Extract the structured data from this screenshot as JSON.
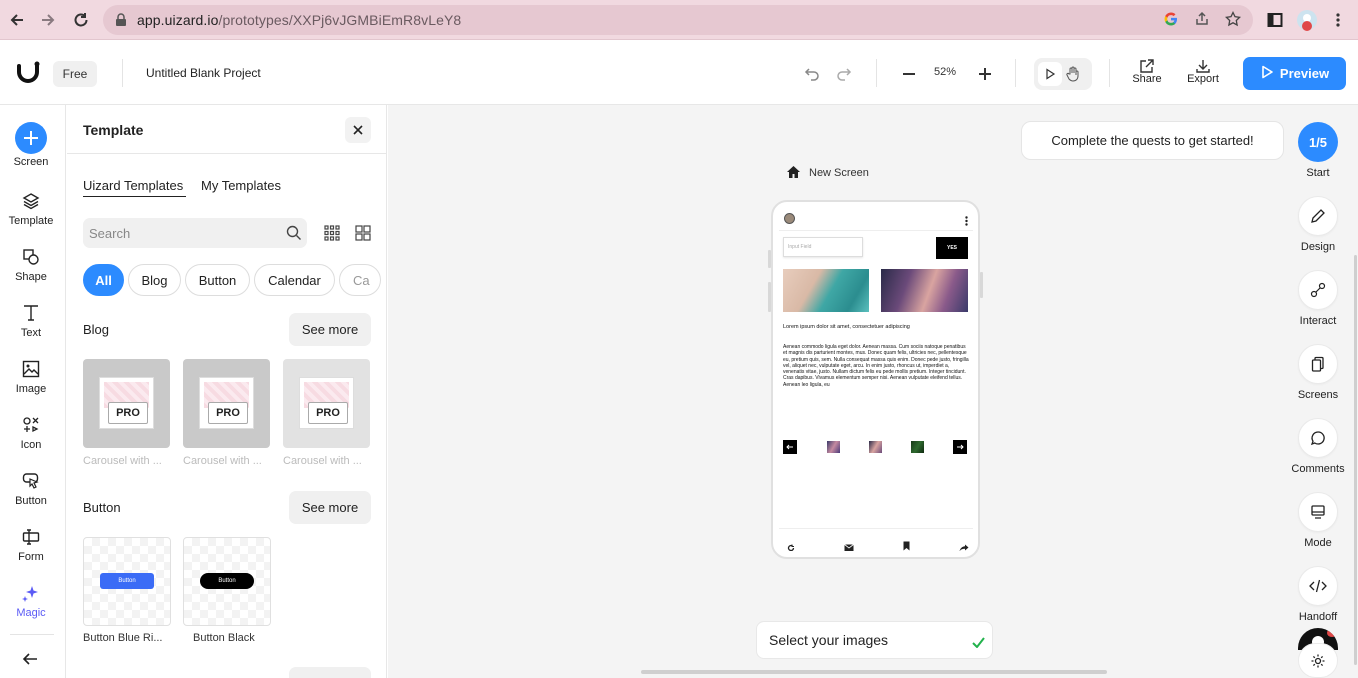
{
  "browser": {
    "url_domain": "app.uizard.io",
    "url_path": "/prototypes/XXPj6vJGMBiEmR8vLeY8"
  },
  "header": {
    "plan_badge": "Free",
    "project_title": "Untitled Blank Project",
    "zoom": "52%",
    "share_label": "Share",
    "export_label": "Export",
    "preview_label": "Preview"
  },
  "left_toolbar": {
    "items": [
      {
        "label": "Screen",
        "icon": "plus-icon"
      },
      {
        "label": "Template",
        "icon": "layers-icon"
      },
      {
        "label": "Shape",
        "icon": "shape-icon"
      },
      {
        "label": "Text",
        "icon": "text-icon"
      },
      {
        "label": "Image",
        "icon": "image-icon"
      },
      {
        "label": "Icon",
        "icon": "icon-set-icon"
      },
      {
        "label": "Button",
        "icon": "pointer-icon"
      },
      {
        "label": "Form",
        "icon": "form-icon"
      },
      {
        "label": "Magic",
        "icon": "sparkle-icon"
      }
    ],
    "accent_color": "#2c8bff",
    "magic_color": "#5b5bf5"
  },
  "template_panel": {
    "title": "Template",
    "tabs": [
      "Uizard Templates",
      "My Templates"
    ],
    "search_placeholder": "Search",
    "chips": [
      "All",
      "Blog",
      "Button",
      "Calendar",
      "Ca"
    ],
    "blog": {
      "heading": "Blog",
      "see_more": "See more",
      "cards": [
        {
          "badge": "PRO",
          "caption": "Carousel with ..."
        },
        {
          "badge": "PRO",
          "caption": "Carousel with ..."
        },
        {
          "badge": "PRO",
          "caption": "Carousel with ..."
        }
      ]
    },
    "button": {
      "heading": "Button",
      "see_more": "See more",
      "cards": [
        {
          "preview_label": "Button",
          "caption": "Button Blue Ri...",
          "color": "#3b6cf6"
        },
        {
          "preview_label": "Button",
          "caption": "Button Black",
          "color": "#000000"
        }
      ]
    }
  },
  "canvas": {
    "quest_text": "Complete the quests to get started!",
    "screen_name": "New Screen",
    "toast_text": "Select your images",
    "phone": {
      "input_placeholder": "Input Field",
      "button_label": "YES",
      "headline": "Lorem ipsum dolor sit amet, consectetuer adipiscing",
      "body": "Aenean commodo ligula eget dolor. Aenean massa. Cum sociis natoque penatibus et magnis dis parturient montes, mus. Donec quam felis, ultricies nec, pellentesque eu, pretium quis, sem. Nulla consequat massa quis enim. Donec pede justo, fringilla vel, aliquet nec, vulputate eget, arcu. In enim justo, rhoncus ut, imperdiet a, venenatis vitae, justo. Nullam dictum felis eu pede mollis pretium. Integer tincidunt. Cras dapibus. Vivamus elementum semper nisi. Aenean vulputate eleifend tellus. Aenean leo ligula, eu"
    }
  },
  "right_toolbar": {
    "start": {
      "value": "1/5",
      "label": "Start"
    },
    "items": [
      {
        "label": "Design",
        "icon": "pencil-icon"
      },
      {
        "label": "Interact",
        "icon": "link-nodes-icon"
      },
      {
        "label": "Screens",
        "icon": "screens-icon"
      },
      {
        "label": "Comments",
        "icon": "comment-icon"
      },
      {
        "label": "Mode",
        "icon": "monitor-icon"
      },
      {
        "label": "Handoff",
        "icon": "code-icon"
      }
    ]
  }
}
